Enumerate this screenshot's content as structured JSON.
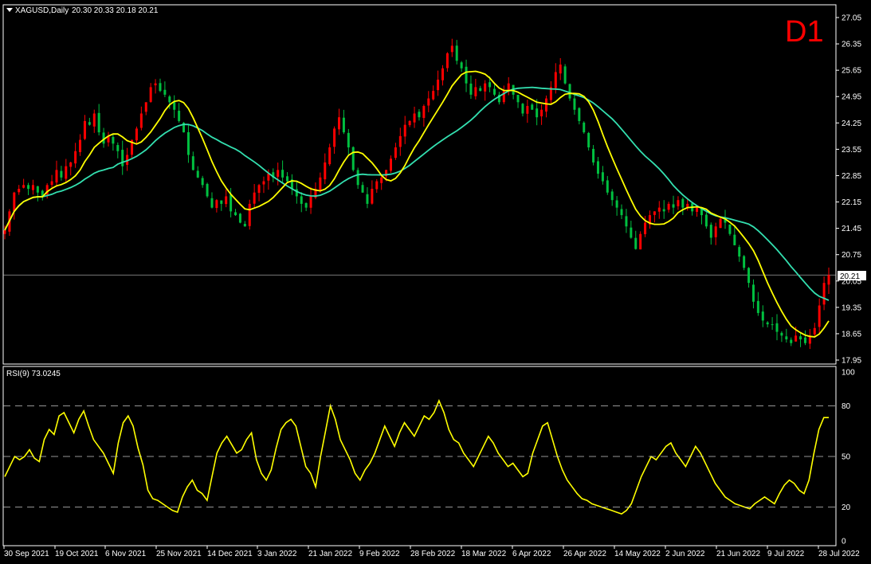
{
  "header": {
    "symbol": "XAGUSD,Daily",
    "ohlc": "20.30 20.33 20.18 20.21",
    "timeframe": "D1"
  },
  "colors": {
    "background": "#000000",
    "grid_frame": "#ffffff",
    "bull": "#ff0000",
    "bear": "#00c040",
    "ma_fast": "#ffff00",
    "ma_slow": "#33e0b0",
    "rsi": "#ffff00",
    "price_line": "#c0c0c0"
  },
  "chart_data": [
    {
      "type": "line",
      "title": "XAGUSD,Daily",
      "ylim": [
        17.95,
        27.05
      ],
      "yticks": [
        "27.05",
        "26.35",
        "25.65",
        "24.95",
        "24.25",
        "23.55",
        "22.85",
        "22.15",
        "21.45",
        "20.75",
        "20.05",
        "19.35",
        "18.65",
        "17.95"
      ],
      "current_price_label": "20.21",
      "current_price": 20.21,
      "candles_close": [
        21.4,
        21.9,
        22.4,
        22.5,
        22.6,
        22.5,
        22.6,
        22.4,
        22.3,
        22.6,
        22.7,
        23.0,
        22.8,
        23.1,
        23.2,
        23.5,
        23.8,
        24.3,
        24.2,
        24.5,
        24.0,
        23.7,
        23.9,
        23.7,
        23.5,
        23.1,
        23.4,
        23.8,
        24.1,
        24.5,
        24.8,
        25.2,
        25.3,
        25.1,
        25.0,
        24.8,
        24.6,
        24.3,
        24.0,
        23.4,
        23.0,
        22.8,
        22.6,
        22.3,
        22.0,
        22.2,
        22.1,
        22.3,
        21.9,
        21.8,
        21.6,
        21.5,
        22.1,
        22.4,
        22.6,
        22.7,
        22.9,
        22.8,
        23.0,
        22.8,
        22.7,
        22.5,
        22.3,
        22.1,
        22.0,
        22.3,
        22.5,
        22.8,
        23.2,
        23.6,
        24.1,
        24.4,
        24.0,
        23.6,
        23.0,
        22.6,
        22.4,
        22.1,
        22.5,
        22.7,
        22.8,
        23.0,
        23.3,
        23.6,
        23.9,
        24.2,
        24.3,
        24.5,
        24.4,
        24.7,
        24.9,
        25.1,
        25.4,
        25.7,
        26.1,
        26.3,
        25.9,
        25.7,
        25.3,
        25.0,
        25.2,
        25.1,
        25.3,
        25.2,
        25.0,
        24.8,
        25.1,
        25.3,
        25.0,
        24.8,
        24.5,
        24.7,
        24.6,
        24.4,
        24.6,
        24.9,
        25.2,
        25.6,
        25.8,
        25.3,
        24.9,
        24.6,
        24.3,
        24.0,
        23.6,
        23.2,
        22.9,
        22.7,
        22.4,
        22.2,
        22.0,
        21.8,
        21.5,
        21.2,
        20.9,
        21.3,
        21.6,
        21.8,
        21.9,
        22.0,
        21.9,
        22.1,
        22.0,
        22.2,
        22.0,
        22.1,
        21.9,
        22.0,
        21.8,
        21.5,
        21.2,
        21.5,
        21.7,
        21.6,
        21.3,
        21.0,
        20.7,
        20.4,
        20.0,
        19.5,
        19.2,
        19.0,
        18.9,
        18.9,
        18.7,
        18.6,
        18.5,
        18.4,
        18.6,
        18.5,
        18.4,
        18.6,
        18.8,
        19.4,
        20.0,
        20.21
      ],
      "series": [
        {
          "values_kind": "candlestick"
        },
        {
          "values_kind": "ma_fast"
        },
        {
          "values_kind": "ma_slow"
        }
      ]
    },
    {
      "type": "line",
      "title": "RSI(9) 73.0245",
      "ylim": [
        0,
        100
      ],
      "yticks": [
        "100",
        "80",
        "50",
        "20",
        "0"
      ],
      "levels": [
        80,
        50,
        20
      ],
      "values": [
        38,
        44,
        50,
        48,
        50,
        54,
        49,
        47,
        60,
        66,
        63,
        74,
        76,
        70,
        64,
        72,
        77,
        68,
        60,
        56,
        52,
        46,
        40,
        58,
        70,
        74,
        68,
        55,
        45,
        30,
        25,
        24,
        22,
        20,
        18,
        17,
        26,
        32,
        36,
        30,
        28,
        24,
        38,
        52,
        58,
        62,
        57,
        52,
        54,
        60,
        64,
        48,
        40,
        36,
        42,
        55,
        66,
        70,
        72,
        68,
        56,
        44,
        40,
        32,
        50,
        65,
        80,
        72,
        60,
        54,
        48,
        40,
        36,
        42,
        46,
        52,
        60,
        68,
        62,
        56,
        64,
        70,
        66,
        62,
        68,
        74,
        72,
        76,
        83,
        76,
        66,
        60,
        58,
        52,
        48,
        44,
        50,
        56,
        62,
        58,
        52,
        48,
        44,
        46,
        42,
        38,
        40,
        52,
        60,
        68,
        70,
        60,
        50,
        42,
        36,
        32,
        28,
        25,
        24,
        22,
        21,
        20,
        19,
        18,
        17,
        16,
        18,
        22,
        30,
        38,
        44,
        50,
        48,
        52,
        56,
        58,
        52,
        48,
        44,
        50,
        56,
        52,
        46,
        40,
        34,
        30,
        26,
        24,
        22,
        21,
        20,
        19,
        22,
        24,
        26,
        24,
        22,
        28,
        33,
        36,
        34,
        30,
        28,
        36,
        52,
        66,
        73,
        73.02
      ],
      "x_labels": [
        "30 Sep 2021",
        "19 Oct 2021",
        "6 Nov 2021",
        "25 Nov 2021",
        "14 Dec 2021",
        "3 Jan 2022",
        "21 Jan 2022",
        "9 Feb 2022",
        "28 Feb 2022",
        "18 Mar 2022",
        "6 Apr 2022",
        "26 Apr 2022",
        "14 May 2022",
        "2 Jun 2022",
        "21 Jun 2022",
        "9 Jul 2022",
        "28 Jul 2022"
      ]
    }
  ]
}
